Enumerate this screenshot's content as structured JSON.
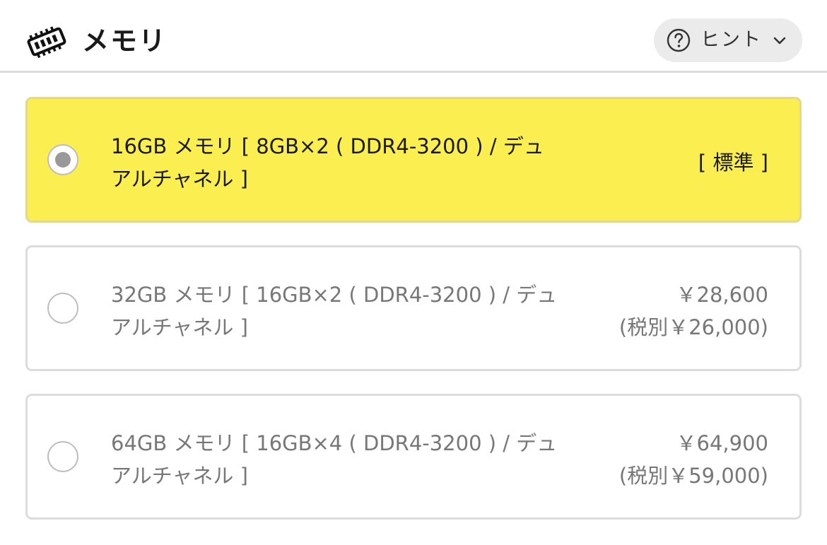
{
  "header": {
    "title": "メモリ",
    "icon": "memory-chip-icon",
    "hint": {
      "label": "ヒント",
      "icon": "question-circle-icon",
      "chevron": "chevron-down-icon"
    }
  },
  "options": [
    {
      "label_line1": "16GB メモリ [ 8GB×2 ( DDR4-3200 ) / デュ",
      "label_line2": "アルチャネル ]",
      "price": "[ 標準 ]",
      "price_excl_tax": "",
      "selected": true
    },
    {
      "label_line1": "32GB メモリ [ 16GB×2 ( DDR4-3200 ) / デュ",
      "label_line2": "アルチャネル ]",
      "price": "￥28,600",
      "price_excl_tax": "(税別￥26,000)",
      "selected": false
    },
    {
      "label_line1": "64GB メモリ [ 16GB×4 ( DDR4-3200 ) / デュ",
      "label_line2": "アルチャネル ]",
      "price": "￥64,900",
      "price_excl_tax": "(税別￥59,000)",
      "selected": false
    }
  ],
  "colors": {
    "selected_bg": "#faee50",
    "border": "#dcdcdc",
    "hint_bg": "#ebebeb",
    "radio_dot": "#999999"
  }
}
